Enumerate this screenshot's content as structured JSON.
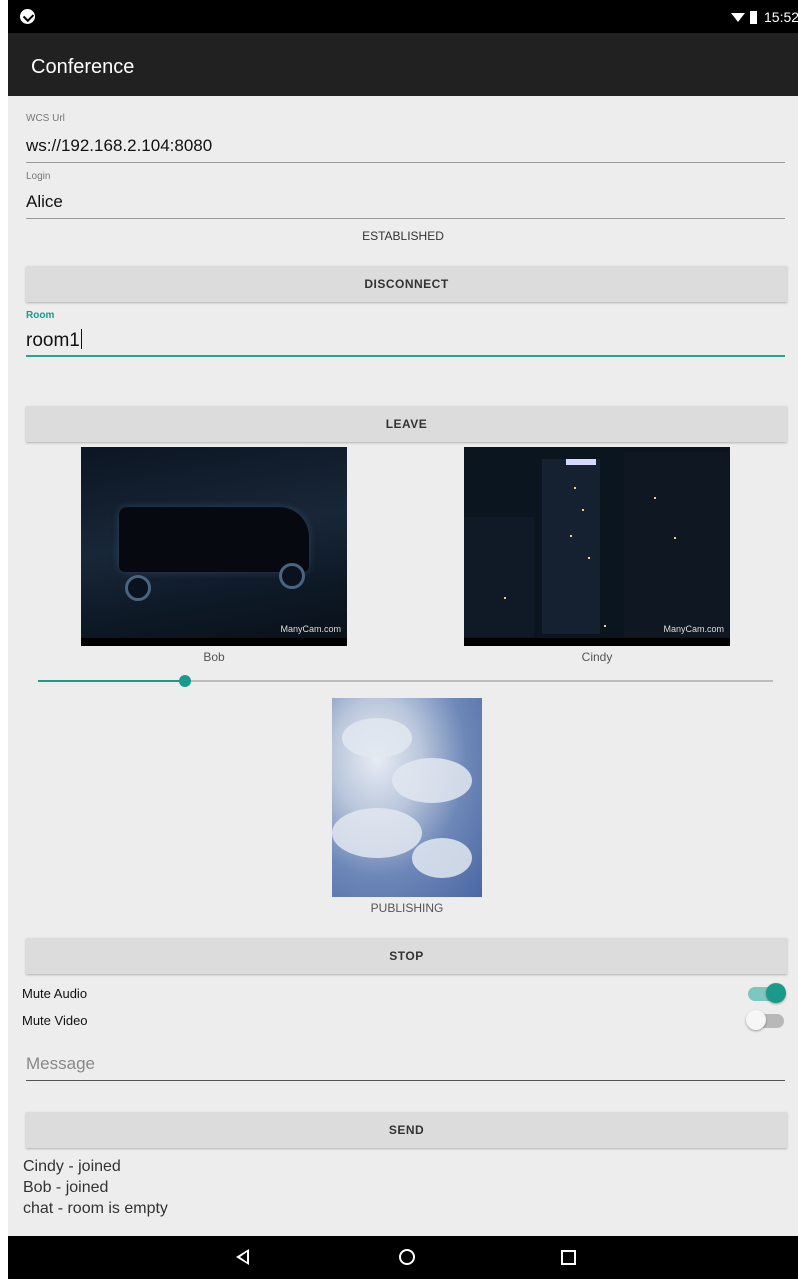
{
  "status_bar": {
    "time": "15:52"
  },
  "app_bar": {
    "title": "Conference"
  },
  "wcs_url": {
    "label": "WCS Url",
    "value": "ws://192.168.2.104:8080"
  },
  "login": {
    "label": "Login",
    "value": "Alice"
  },
  "connection_status": "ESTABLISHED",
  "connect_button": "DISCONNECT",
  "room": {
    "label": "Room",
    "value": "room1"
  },
  "join_button": "LEAVE",
  "participants": [
    {
      "name": "Bob",
      "watermark": "ManyCam.com"
    },
    {
      "name": "Cindy",
      "watermark": "ManyCam.com"
    }
  ],
  "volume_slider": {
    "value_fraction": 0.2
  },
  "publish": {
    "status": "PUBLISHING",
    "button": "STOP"
  },
  "toggles": {
    "mute_audio": {
      "label": "Mute Audio",
      "checked": true
    },
    "mute_video": {
      "label": "Mute Video",
      "checked": false
    }
  },
  "message": {
    "placeholder": "Message",
    "value": ""
  },
  "send_button": "SEND",
  "log": [
    "Cindy - joined",
    "Bob - joined",
    "chat - room is empty"
  ],
  "colors": {
    "accent": "#1a9a8a",
    "app_bar": "#212121",
    "background": "#ededed"
  },
  "icons": [
    "back-icon",
    "home-icon",
    "recents-icon",
    "wifi-icon",
    "battery-icon",
    "notification-icon"
  ]
}
